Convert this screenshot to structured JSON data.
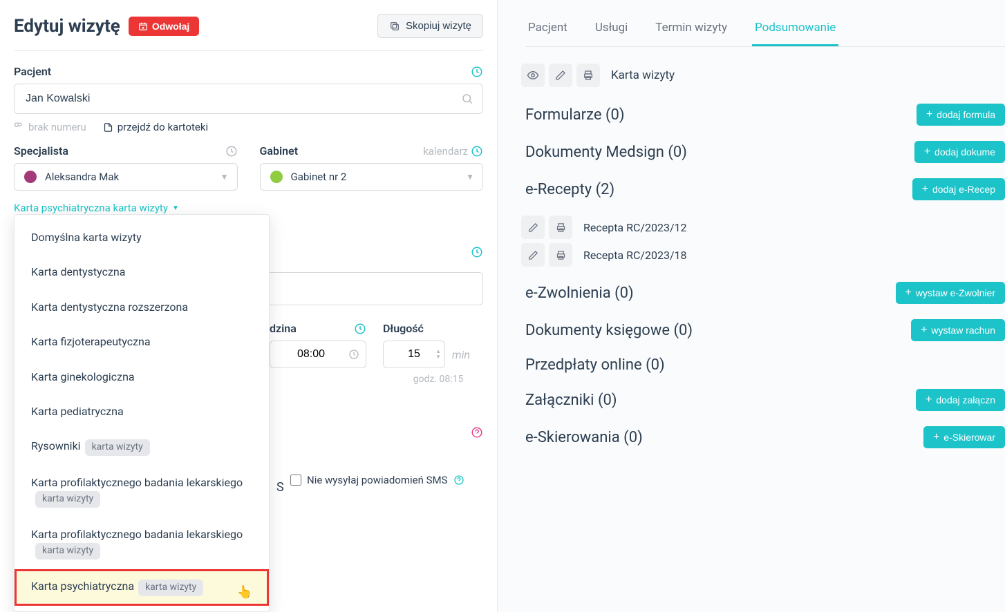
{
  "header": {
    "title": "Edytuj wizytę",
    "cancel_button": "Odwołaj",
    "copy_button": "Skopiuj wizytę"
  },
  "patient": {
    "label": "Pacjent",
    "value": "Jan Kowalski",
    "no_number": "brak numeru",
    "go_to_file": "przejdź do kartoteki"
  },
  "specialist": {
    "label": "Specjalista",
    "value": "Aleksandra Mak"
  },
  "cabinet": {
    "label": "Gabinet",
    "calendar_link": "kalendarz",
    "value": "Gabinet nr 2"
  },
  "visit_card_link": "Karta psychiatryczna karta wizyty",
  "dropdown": {
    "items": [
      {
        "label": "Domyślna karta wizyty",
        "tag": null
      },
      {
        "label": "Karta dentystyczna",
        "tag": null
      },
      {
        "label": "Karta dentystyczna rozszerzona",
        "tag": null
      },
      {
        "label": "Karta fizjoterapeutyczna",
        "tag": null
      },
      {
        "label": "Karta ginekologiczna",
        "tag": null
      },
      {
        "label": "Karta pediatryczna",
        "tag": null
      },
      {
        "label": "Rysowniki",
        "tag": "karta wizyty"
      },
      {
        "label": "Karta profilaktycznego badania lekarskiego",
        "tag": "karta wizyty"
      },
      {
        "label": "Karta profilaktycznego badania lekarskiego",
        "tag": "karta wizyty"
      },
      {
        "label": "Karta psychiatryczna",
        "tag": "karta wizyty",
        "highlighted": true
      }
    ]
  },
  "time": {
    "hour_label": "dzina",
    "hour_value": "08:00",
    "length_label": "Długość",
    "length_value": "15",
    "length_unit": "min",
    "subtime": "godz. 08:15"
  },
  "s_letter": "S",
  "sms_checkbox": "Nie wysyłaj powiadomień SMS",
  "tabs": [
    "Pacjent",
    "Usługi",
    "Termin wizyty",
    "Podsumowanie"
  ],
  "active_tab": 3,
  "visit_card_label": "Karta wizyty",
  "sections": {
    "forms": {
      "title": "Formularze (0)",
      "button": "dodaj formula"
    },
    "medsign": {
      "title": "Dokumenty Medsign (0)",
      "button": "dodaj dokume"
    },
    "erecepty": {
      "title": "e-Recepty (2)",
      "button": "dodaj e-Recep",
      "items": [
        "Recepta RC/2023/12",
        "Recepta RC/2023/18"
      ]
    },
    "ezwolnienia": {
      "title": "e-Zwolnienia (0)",
      "button": "wystaw e-Zwolnier"
    },
    "ksiegowe": {
      "title": "Dokumenty księgowe (0)",
      "button": "wystaw rachun"
    },
    "przedplaty": {
      "title": "Przedpłaty online (0)"
    },
    "zalaczniki": {
      "title": "Załączniki (0)",
      "button": "dodaj załączn"
    },
    "eskierowania": {
      "title": "e-Skierowania (0)",
      "button": "e-Skierowar"
    }
  }
}
